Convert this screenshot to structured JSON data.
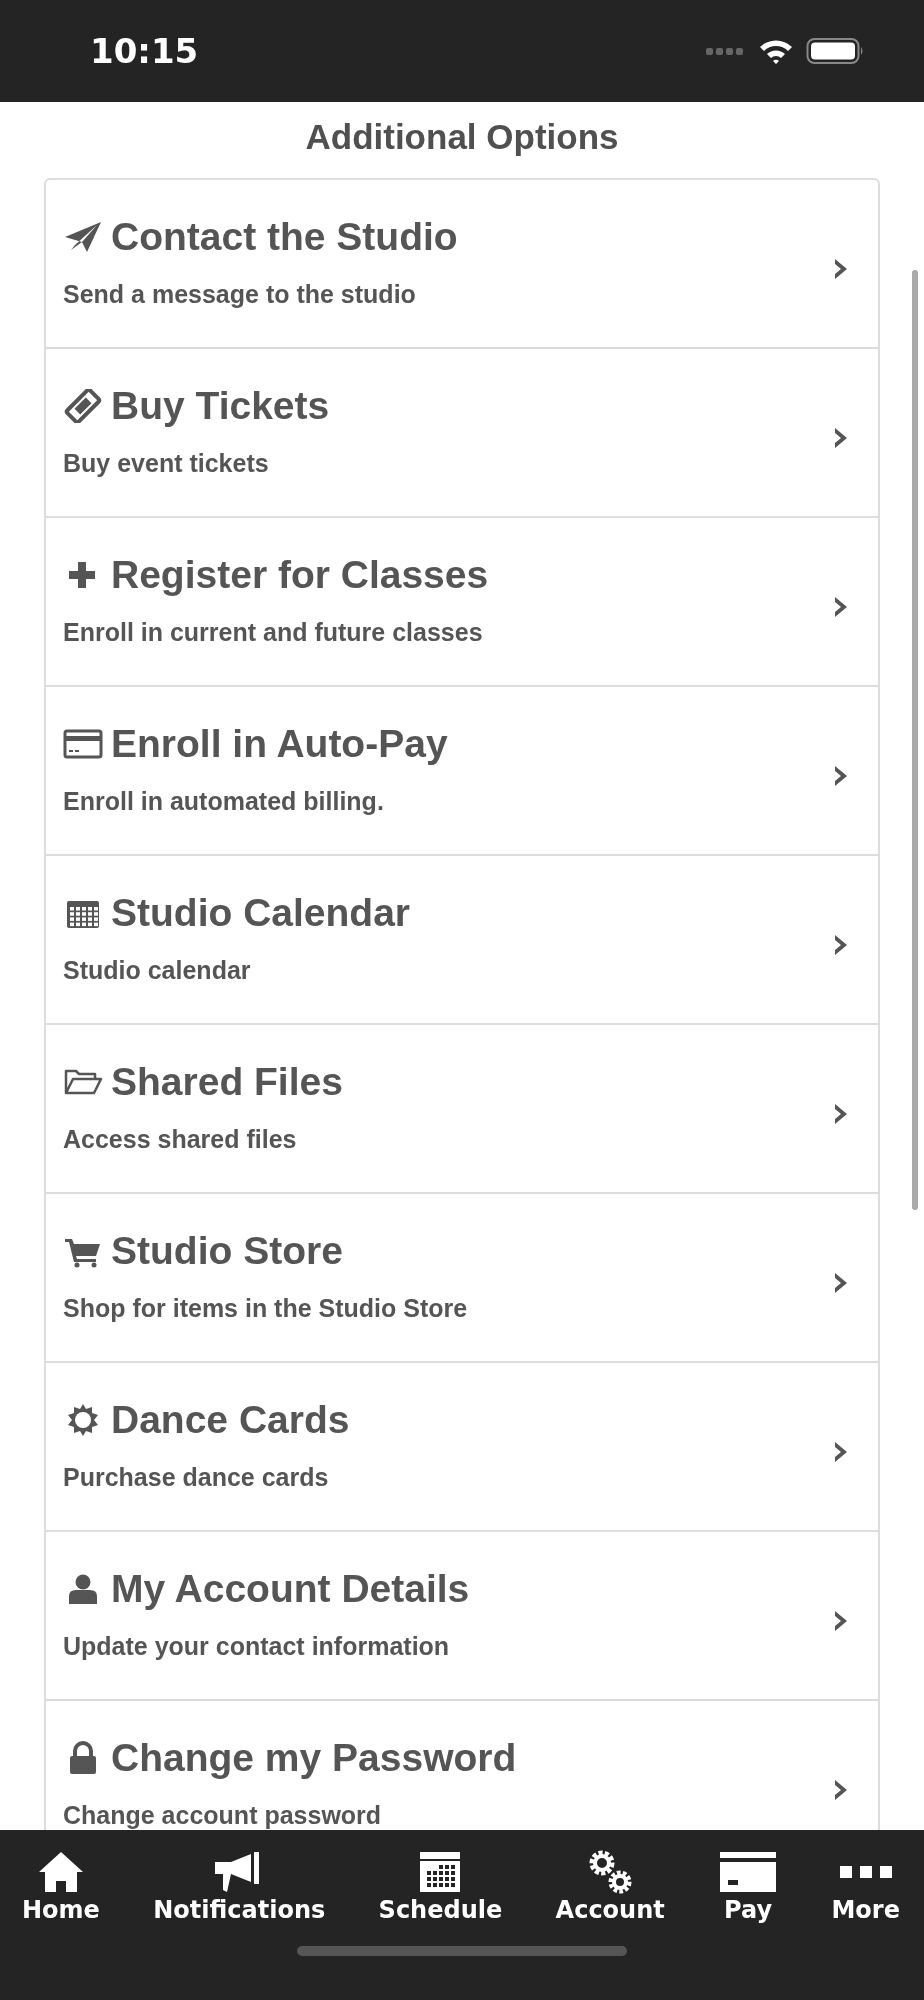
{
  "status_bar": {
    "time": "10:15"
  },
  "title": "Additional Options",
  "options": [
    {
      "kind": "send",
      "title": "Contact the Studio",
      "subtitle": "Send a message to the studio"
    },
    {
      "kind": "ticket",
      "title": "Buy Tickets",
      "subtitle": "Buy event tickets"
    },
    {
      "kind": "plus",
      "title": "Register for Classes",
      "subtitle": "Enroll in current and future classes"
    },
    {
      "kind": "card",
      "title": "Enroll in Auto-Pay",
      "subtitle": "Enroll in automated billing."
    },
    {
      "kind": "calendar",
      "title": "Studio Calendar",
      "subtitle": "Studio calendar"
    },
    {
      "kind": "folder",
      "title": "Shared Files",
      "subtitle": "Access shared files"
    },
    {
      "kind": "cart",
      "title": "Studio Store",
      "subtitle": "Shop for items in the Studio Store"
    },
    {
      "kind": "sun",
      "title": "Dance Cards",
      "subtitle": "Purchase dance cards"
    },
    {
      "kind": "user",
      "title": "My Account Details",
      "subtitle": "Update your contact information"
    },
    {
      "kind": "lock",
      "title": "Change my Password",
      "subtitle": "Change account password"
    }
  ],
  "tabs": [
    {
      "kind": "home",
      "label": "Home"
    },
    {
      "kind": "megaphone",
      "label": "Notifications"
    },
    {
      "kind": "calendar",
      "label": "Schedule"
    },
    {
      "kind": "gears",
      "label": "Account"
    },
    {
      "kind": "card",
      "label": "Pay"
    },
    {
      "kind": "dots",
      "label": "More"
    }
  ]
}
